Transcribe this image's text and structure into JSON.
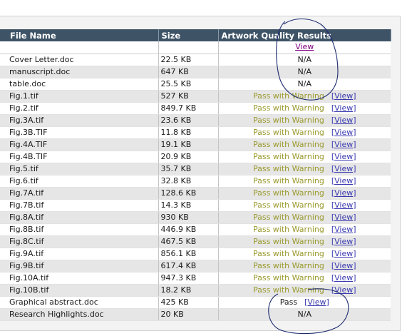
{
  "table": {
    "headers": {
      "file_name": "File Name",
      "size": "Size",
      "results": "Artwork Quality Results"
    },
    "header_view_link": "View",
    "rows": [
      {
        "name": "Cover Letter.doc",
        "size": "22.5 KB",
        "result": "N/A",
        "link": ""
      },
      {
        "name": "manuscript.doc",
        "size": "647 KB",
        "result": "N/A",
        "link": ""
      },
      {
        "name": "table.doc",
        "size": "25.5 KB",
        "result": "N/A",
        "link": ""
      },
      {
        "name": "Fig.1.tif",
        "size": "527 KB",
        "result": "Pass with Warning",
        "link": "[View]"
      },
      {
        "name": "Fig.2.tif",
        "size": "849.7 KB",
        "result": "Pass with Warning",
        "link": "[View]"
      },
      {
        "name": "Fig.3A.tif",
        "size": "23.6 KB",
        "result": "Pass with Warning",
        "link": "[View]"
      },
      {
        "name": "Fig.3B.TIF",
        "size": "11.8 KB",
        "result": "Pass with Warning",
        "link": "[View]"
      },
      {
        "name": "Fig.4A.TIF",
        "size": "19.1 KB",
        "result": "Pass with Warning",
        "link": "[View]"
      },
      {
        "name": "Fig.4B.TIF",
        "size": "20.9 KB",
        "result": "Pass with Warning",
        "link": "[View]"
      },
      {
        "name": "Fig.5.tif",
        "size": "35.7 KB",
        "result": "Pass with Warning",
        "link": "[View]"
      },
      {
        "name": "Fig.6.tif",
        "size": "32.8 KB",
        "result": "Pass with Warning",
        "link": "[View]"
      },
      {
        "name": "Fig.7A.tif",
        "size": "128.6 KB",
        "result": "Pass with Warning",
        "link": "[View]"
      },
      {
        "name": "Fig.7B.tif",
        "size": "14.3 KB",
        "result": "Pass with Warning",
        "link": "[View]"
      },
      {
        "name": "Fig.8A.tif",
        "size": "930 KB",
        "result": "Pass with Warning",
        "link": "[View]"
      },
      {
        "name": "Fig.8B.tif",
        "size": "446.9 KB",
        "result": "Pass with Warning",
        "link": "[View]"
      },
      {
        "name": "Fig.8C.tif",
        "size": "467.5 KB",
        "result": "Pass with Warning",
        "link": "[View]"
      },
      {
        "name": "Fig.9A.tif",
        "size": "856.1 KB",
        "result": "Pass with Warning",
        "link": "[View]"
      },
      {
        "name": "Fig.9B.tif",
        "size": "617.4 KB",
        "result": "Pass with Warning",
        "link": "[View]"
      },
      {
        "name": "Fig.10A.tif",
        "size": "947.3 KB",
        "result": "Pass with Warning",
        "link": "[View]"
      },
      {
        "name": "Fig.10B.tif",
        "size": "18.2 KB",
        "result": "Pass with Warning",
        "link": "[View]"
      },
      {
        "name": "Graphical abstract.doc",
        "size": "425 KB",
        "result": "Pass",
        "link": "[View]"
      },
      {
        "name": "Research Highlights.doc",
        "size": "20 KB",
        "result": "N/A",
        "link": ""
      }
    ]
  },
  "colors": {
    "header_bg": "#3e5366",
    "warning_text": "#9a9a2e",
    "link": "#3a3ab0",
    "annotation_ink": "#1c2a6e"
  }
}
